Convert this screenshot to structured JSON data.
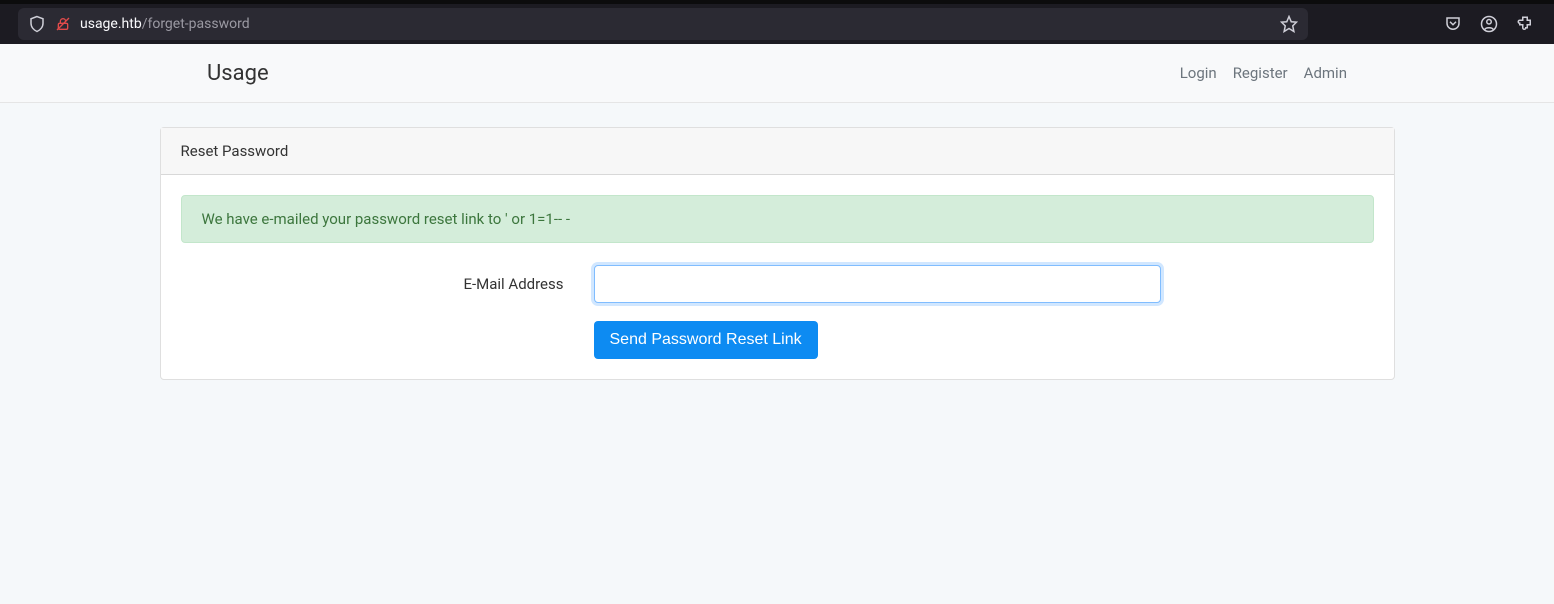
{
  "browser": {
    "url_host": "usage.htb",
    "url_path": "/forget-password"
  },
  "navbar": {
    "brand": "Usage",
    "links": {
      "login": "Login",
      "register": "Register",
      "admin": "Admin"
    }
  },
  "card": {
    "header": "Reset Password",
    "alert": "We have e-mailed your password reset link to ' or 1=1-- -",
    "email_label": "E-Mail Address",
    "email_value": "",
    "submit_label": "Send Password Reset Link"
  }
}
